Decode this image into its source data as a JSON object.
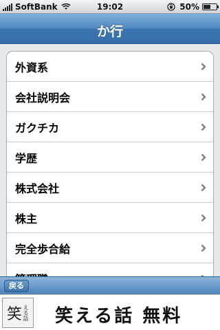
{
  "status": {
    "carrier": "SoftBank",
    "time": "19:02",
    "battery": "50%",
    "battery_level": 0.5
  },
  "nav": {
    "title": "か行"
  },
  "list": {
    "items": [
      {
        "label": "外資系"
      },
      {
        "label": "会社説明会"
      },
      {
        "label": "ガクチカ"
      },
      {
        "label": "学歴"
      },
      {
        "label": "株式会社"
      },
      {
        "label": "株主"
      },
      {
        "label": "完全歩合給"
      },
      {
        "label": "管理職"
      }
    ]
  },
  "toolbar": {
    "back_label": "戻る"
  },
  "banner": {
    "logo_main": "笑",
    "logo_sub": "える話",
    "text": "笑える話 無料"
  },
  "colors": {
    "nav_blue": "#4e88c0",
    "chevron": "#7f7f7f"
  },
  "icons": [
    "signal-icon",
    "wifi-icon",
    "rotation-lock-icon",
    "battery-icon",
    "chevron-right-icon"
  ]
}
